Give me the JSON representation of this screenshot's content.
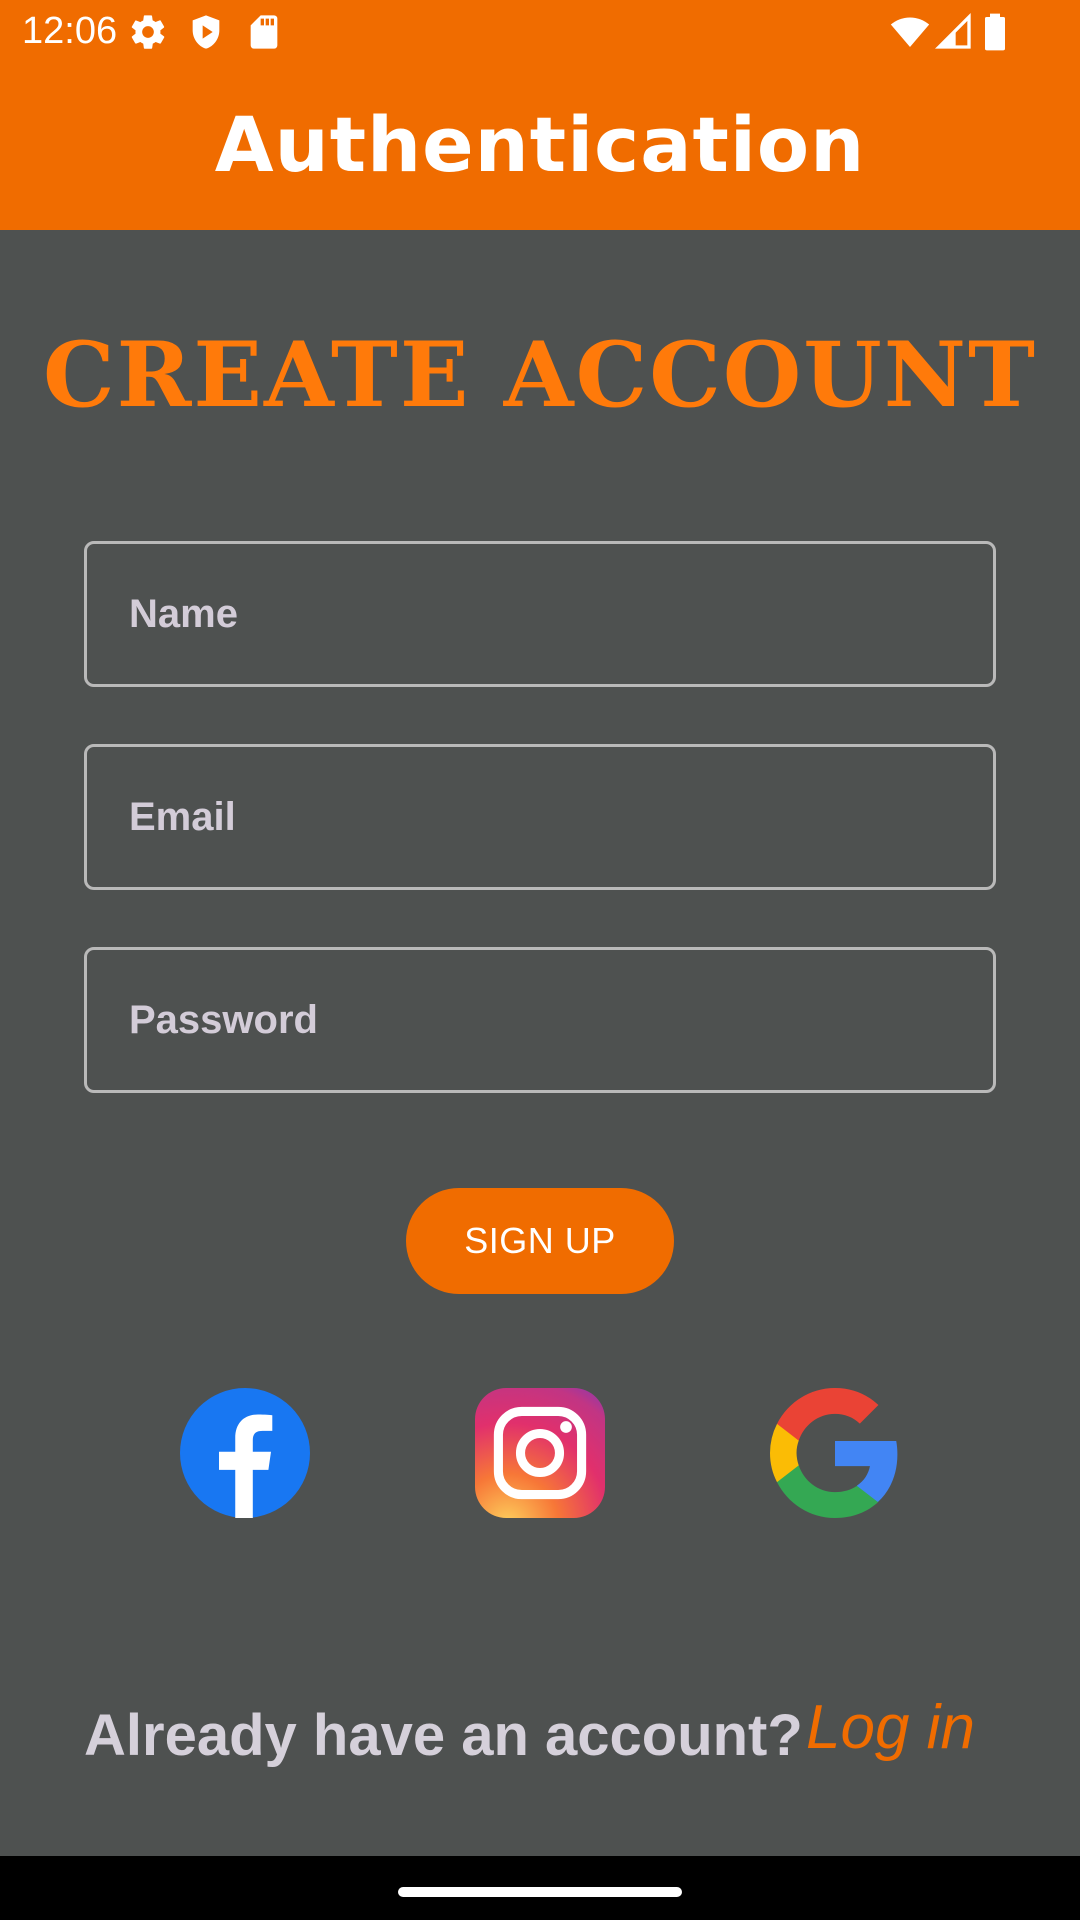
{
  "status_bar": {
    "time": "12:06",
    "left_icons": [
      "gear-icon",
      "play-protect-icon",
      "sd-card-icon"
    ],
    "right_icons": [
      "wifi-icon",
      "cell-signal-icon",
      "battery-icon"
    ]
  },
  "app_bar": {
    "title": "Authentication"
  },
  "heading": "CREATE ACCOUNT",
  "form": {
    "name_placeholder": "Name",
    "email_placeholder": "Email",
    "password_placeholder": "Password",
    "signup_label": "SIGN UP"
  },
  "social": [
    "facebook-icon",
    "instagram-icon",
    "google-icon"
  ],
  "footer": {
    "prompt": "Already have an account?",
    "login_label": "Log in"
  },
  "colors": {
    "accent": "#f06c00",
    "heading": "#ff7a0a",
    "background": "#4e5150",
    "text_muted": "#d5d0da"
  }
}
